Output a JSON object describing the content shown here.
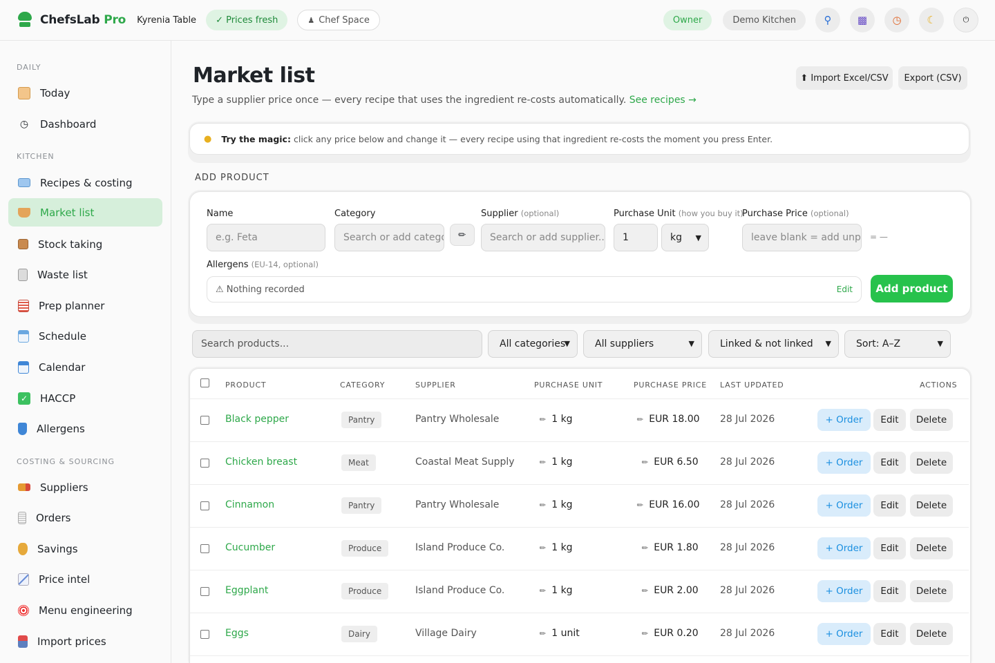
{
  "topbar": {
    "brand": "ChefsLab",
    "brand_suffix": "Pro",
    "restaurant": "Kyrenia Table",
    "prices_status": "✓ Prices fresh",
    "chef_space": "Chef Space",
    "role": "Owner",
    "kitchen": "Demo Kitchen"
  },
  "sidebar": {
    "sections": [
      {
        "title": "DAILY"
      },
      {
        "title": "KITCHEN"
      },
      {
        "title": "COSTING & SOURCING"
      }
    ],
    "items": [
      {
        "label": "Today",
        "icon": "clipboard-icon"
      },
      {
        "label": "Dashboard",
        "icon": "clock-icon"
      },
      {
        "label": "Recipes & costing",
        "icon": "book-icon"
      },
      {
        "label": "Market list",
        "icon": "basket-icon"
      },
      {
        "label": "Stock taking",
        "icon": "box-icon"
      },
      {
        "label": "Waste list",
        "icon": "trash-icon"
      },
      {
        "label": "Prep planner",
        "icon": "planner-icon"
      },
      {
        "label": "Schedule",
        "icon": "schedule-icon"
      },
      {
        "label": "Calendar",
        "icon": "calendar-icon"
      },
      {
        "label": "HACCP",
        "icon": "check-icon"
      },
      {
        "label": "Allergens",
        "icon": "shield-icon"
      },
      {
        "label": "Suppliers",
        "icon": "truck-icon"
      },
      {
        "label": "Orders",
        "icon": "receipt-icon"
      },
      {
        "label": "Savings",
        "icon": "money-bag-icon"
      },
      {
        "label": "Price intel",
        "icon": "chart-icon"
      },
      {
        "label": "Menu engineering",
        "icon": "target-icon"
      },
      {
        "label": "Import prices",
        "icon": "inbox-icon"
      }
    ]
  },
  "page": {
    "title": "Market list",
    "subtitle": "Type a supplier price once — every recipe that uses the ingredient re-costs automatically.",
    "subtitle_link": "See recipes →",
    "import_button": "⬆ Import Excel/CSV",
    "export_button": "Export (CSV)",
    "tip_bold": "Try the magic:",
    "tip_text": "click any price below and change it — every recipe using that ingredient re-costs the moment you press Enter.",
    "section_label": "ADD PRODUCT"
  },
  "add_product": {
    "name_label": "Name",
    "name_placeholder": "e.g. Feta",
    "category_label": "Category",
    "category_placeholder": "Search or add category",
    "supplier_label": "Supplier",
    "supplier_optional": "(optional)",
    "supplier_placeholder": "Search or add supplier...",
    "unit_label": "Purchase Unit",
    "unit_hint": "(how you buy it)",
    "unit_qty": "1",
    "unit_value": "kg",
    "price_label": "Purchase Price",
    "price_optional": "(optional)",
    "price_placeholder": "leave blank = add unpriced",
    "equals": "= —",
    "allergens_label": "Allergens",
    "allergens_hint": "(EU-14, optional)",
    "allergens_value": "⚠  Nothing recorded",
    "allergens_edit": "Edit",
    "submit": "Add product"
  },
  "filters": {
    "search_placeholder": "Search products...",
    "category": "All categories",
    "supplier": "All suppliers",
    "linked": "Linked & not linked",
    "sort": "Sort: A–Z"
  },
  "table": {
    "headers": [
      "PRODUCT",
      "CATEGORY",
      "SUPPLIER",
      "PURCHASE UNIT",
      "PURCHASE PRICE",
      "LAST UPDATED",
      "ACTIONS"
    ],
    "actions": {
      "order": "+ Order",
      "edit": "Edit",
      "delete": "Delete"
    },
    "rows": [
      {
        "product": "Black pepper",
        "category": "Pantry",
        "supplier": "Pantry Wholesale",
        "unit": "1 kg",
        "price": "EUR 18.00",
        "updated": "28 Jul 2026"
      },
      {
        "product": "Chicken breast",
        "category": "Meat",
        "supplier": "Coastal Meat Supply",
        "unit": "1 kg",
        "price": "EUR 6.50",
        "updated": "28 Jul 2026"
      },
      {
        "product": "Cinnamon",
        "category": "Pantry",
        "supplier": "Pantry Wholesale",
        "unit": "1 kg",
        "price": "EUR 16.00",
        "updated": "28 Jul 2026"
      },
      {
        "product": "Cucumber",
        "category": "Produce",
        "supplier": "Island Produce Co.",
        "unit": "1 kg",
        "price": "EUR 1.80",
        "updated": "28 Jul 2026"
      },
      {
        "product": "Eggplant",
        "category": "Produce",
        "supplier": "Island Produce Co.",
        "unit": "1 kg",
        "price": "EUR 2.00",
        "updated": "28 Jul 2026"
      },
      {
        "product": "Eggs",
        "category": "Dairy",
        "supplier": "Village Dairy",
        "unit": "1 unit",
        "price": "EUR 0.20",
        "updated": "28 Jul 2026"
      }
    ]
  },
  "colors": {
    "accent": "#2ea84a",
    "accent_bg": "#d6efdb",
    "order_blue": "#1a8fe0"
  }
}
